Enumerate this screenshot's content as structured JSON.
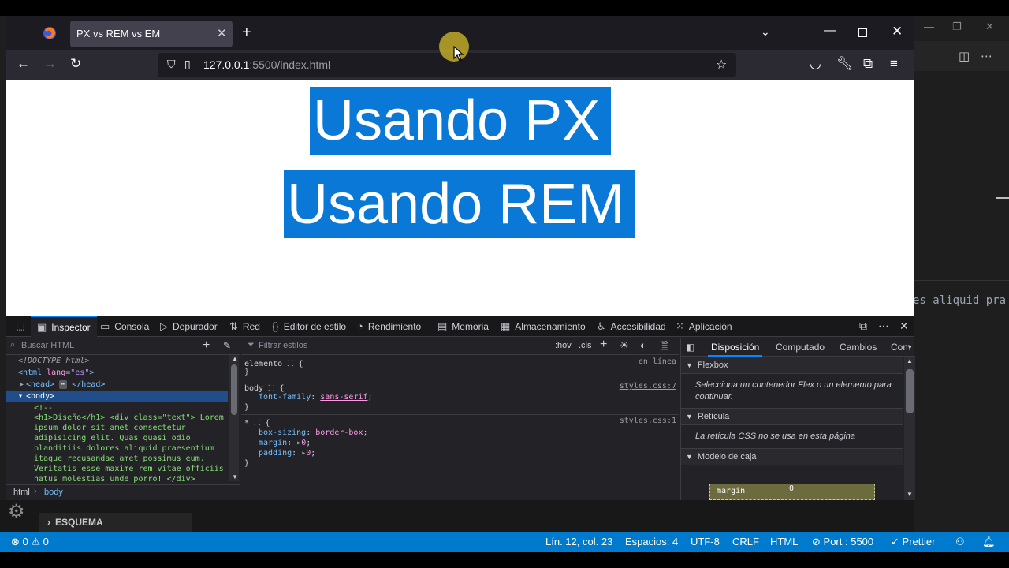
{
  "browser": {
    "tab_title": "PX vs REM vs EM",
    "url_host": "127.0.0.1",
    "url_rest": ":5500/index.html"
  },
  "page": {
    "heading_px": "Usando PX",
    "heading_rem": "Usando REM",
    "highlight_color": "#0a78d7"
  },
  "devtools": {
    "tabs": [
      "Inspector",
      "Consola",
      "Depurador",
      "Red",
      "Editor de estilo",
      "Rendimiento",
      "Memoria",
      "Almacenamiento",
      "Accesibilidad",
      "Aplicación"
    ],
    "search_placeholder": "Buscar HTML",
    "filter_placeholder": "Filtrar estilos",
    "hov_label": ":hov",
    "cls_label": ".cls",
    "markup": {
      "doctype": "<!DOCTYPE html>",
      "html_open": "<html",
      "html_attr": "lang",
      "html_attr_val": "\"es\"",
      "head_open": "<head>",
      "head_close": "</head>",
      "body_open": "<body>",
      "comment_open": "<!--",
      "comment_lines": [
        "<h1>Diseño</h1> <div class=\"text\"> Lorem",
        "ipsum dolor sit amet consectetur",
        "adipisicing elit. Quas quasi odio",
        "blanditiis dolores aliquid praesentium",
        "itaque recusandae amet possimus eum.",
        "Veritatis esse maxime rem vitae officiis",
        "natus molestias unde porro! </div>"
      ]
    },
    "breadcrumbs": [
      "html",
      "body"
    ],
    "rules": {
      "element_selector": "elemento",
      "element_source": "en línea",
      "body_selector": "body",
      "body_source": "styles.css:7",
      "body_prop": "font-family",
      "body_val": "sans-serif",
      "star_selector": "*",
      "star_source": "styles.css:1",
      "star_props": [
        {
          "prop": "box-sizing",
          "val": "border-box"
        },
        {
          "prop": "margin",
          "val": "0"
        },
        {
          "prop": "padding",
          "val": "0"
        }
      ]
    },
    "layout": {
      "tabs": [
        "Disposición",
        "Computado",
        "Cambios",
        "Com"
      ],
      "flexbox_title": "Flexbox",
      "flexbox_note": "Selecciona un contenedor Flex o un elemento para continuar.",
      "grid_title": "Retícula",
      "grid_note": "La retícula CSS no se usa en esta página",
      "boxmodel_title": "Modelo de caja",
      "margin_label": "margin",
      "margin_value": "0"
    }
  },
  "vscode": {
    "code_snippet": "es aliquid pra",
    "outline_label": "ESQUEMA",
    "status": {
      "errors": "0",
      "warnings": "0",
      "position": "Lín. 12, col. 23",
      "spaces": "Espacios: 4",
      "encoding": "UTF-8",
      "eol": "CRLF",
      "language": "HTML",
      "port": "Port : 5500",
      "prettier": "Prettier"
    },
    "statusbar_color": "#007acc"
  }
}
